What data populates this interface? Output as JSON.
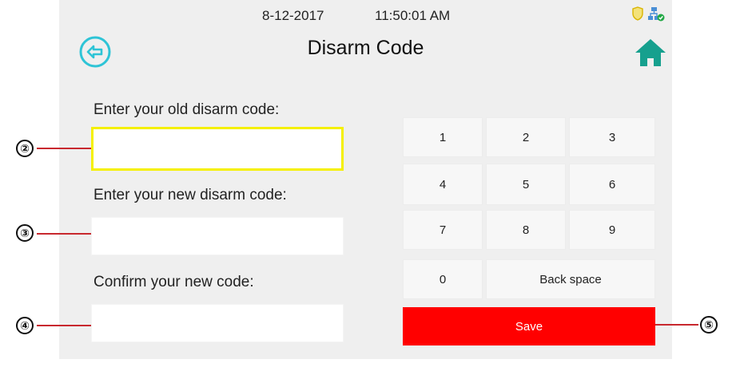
{
  "status_bar": {
    "date": "8-12-2017",
    "time": "11:50:01 AM",
    "icons": [
      "shield-icon",
      "network-ok-icon"
    ]
  },
  "header": {
    "title": "Disarm Code",
    "back_icon": "back-arrow-icon",
    "home_icon": "home-icon"
  },
  "form": {
    "old_label": "Enter your old disarm code:",
    "new_label": "Enter your new disarm code:",
    "confirm_label": "Confirm your new code:",
    "old_value": "",
    "new_value": "",
    "confirm_value": ""
  },
  "keypad": {
    "keys": [
      "1",
      "2",
      "3",
      "4",
      "5",
      "6",
      "7",
      "8",
      "9",
      "0"
    ],
    "backspace": "Back space",
    "save": "Save"
  },
  "callouts": [
    "②",
    "③",
    "④",
    "⑤"
  ],
  "colors": {
    "accent_cyan": "#2ec4d6",
    "home_teal": "#16a08e",
    "active_field_border": "#f5f000",
    "save_red": "#ff0000"
  }
}
